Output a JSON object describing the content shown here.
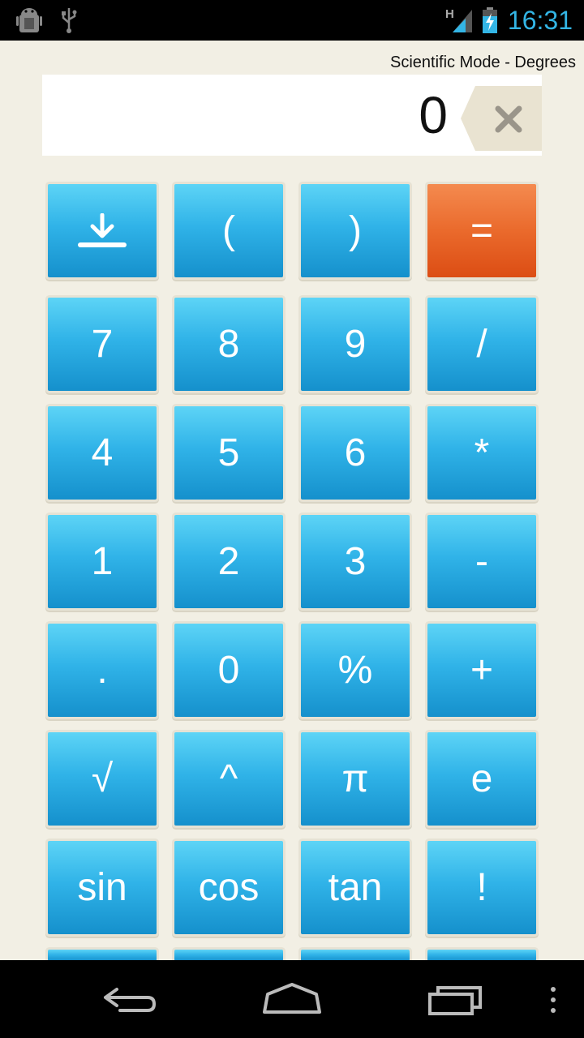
{
  "status_bar": {
    "time": "16:31",
    "network_type": "H",
    "icons": [
      "android-debug-icon",
      "usb-icon",
      "signal-icon",
      "battery-charging-icon"
    ]
  },
  "mode_label": "Scientific Mode - Degrees",
  "display": {
    "value": "0"
  },
  "backspace_icon": "backspace-x-icon",
  "keys": [
    [
      {
        "label": "",
        "icon": "download-icon"
      },
      {
        "label": "("
      },
      {
        "label": ")"
      },
      {
        "label": "="
      }
    ],
    [
      {
        "label": "7"
      },
      {
        "label": "8"
      },
      {
        "label": "9"
      },
      {
        "label": "/"
      }
    ],
    [
      {
        "label": "4"
      },
      {
        "label": "5"
      },
      {
        "label": "6"
      },
      {
        "label": "*"
      }
    ],
    [
      {
        "label": "1"
      },
      {
        "label": "2"
      },
      {
        "label": "3"
      },
      {
        "label": "-"
      }
    ],
    [
      {
        "label": "."
      },
      {
        "label": "0"
      },
      {
        "label": "%"
      },
      {
        "label": "+"
      }
    ],
    [
      {
        "label": "√"
      },
      {
        "label": "^"
      },
      {
        "label": "π"
      },
      {
        "label": "e"
      }
    ],
    [
      {
        "label": "sin"
      },
      {
        "label": "cos"
      },
      {
        "label": "tan"
      },
      {
        "label": "!"
      }
    ]
  ],
  "colors": {
    "key_blue": "#30b3e8",
    "key_orange": "#ea6a2c",
    "background": "#f2efe4",
    "clock": "#33b5e5"
  },
  "nav_bar": {
    "icons": [
      "back-icon",
      "home-icon",
      "recent-apps-icon",
      "menu-icon"
    ]
  }
}
